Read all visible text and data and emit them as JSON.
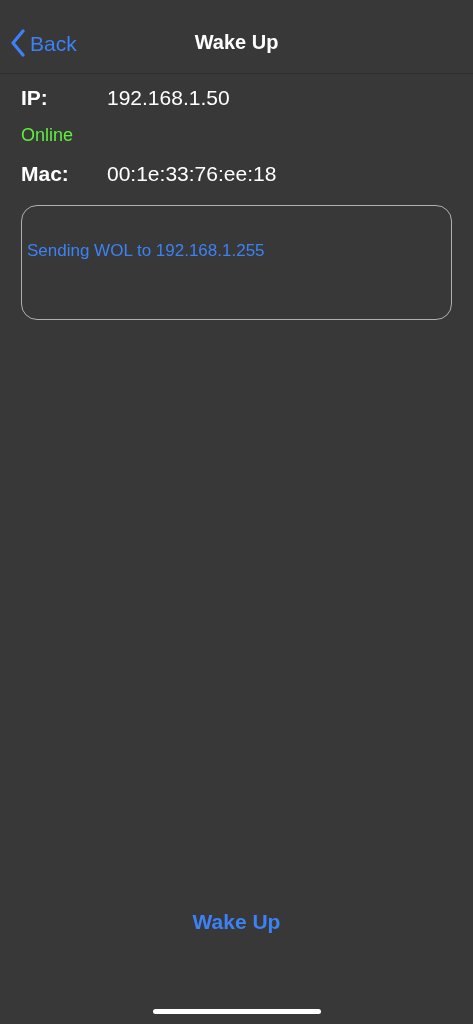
{
  "nav_bar": {
    "back_label": "Back",
    "title": "Wake Up"
  },
  "ip": {
    "label": "IP:",
    "value": "192.168.1.50"
  },
  "status": {
    "text": "Online",
    "online": true
  },
  "mac": {
    "label": "Mac:",
    "value": "00:1e:33:76:ee:18"
  },
  "log": {
    "text": "Sending WOL to 192.168.1.255"
  },
  "wake_button": {
    "label": "Wake Up"
  }
}
